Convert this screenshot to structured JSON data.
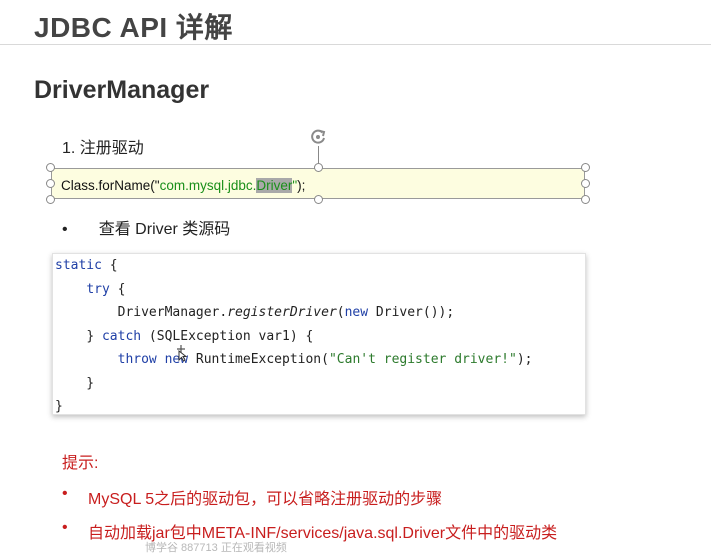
{
  "slide": {
    "title": "JDBC API 详解",
    "section": "DriverManager",
    "step": "1.  注册驱动",
    "textbox": {
      "prefix": "Class.forName(\"",
      "string_main": "com.mysql.jdbc.",
      "string_selected": "Driver",
      "suffix_quote": "\"",
      "suffix": ");"
    },
    "bullet": {
      "marker": "•",
      "text": "查看 Driver 类源码"
    },
    "code": {
      "line1_kw": "static",
      "line1_rest": " {",
      "line2_indent": "    ",
      "line2_kw": "try",
      "line2_rest": " {",
      "line3_indent": "        ",
      "line3_a": "DriverManager.",
      "line3_method": "registerDriver",
      "line3_b": "(",
      "line3_kw": "new",
      "line3_c": " Driver());",
      "line4_indent": "    ",
      "line4_a": "} ",
      "line4_kw": "catch",
      "line4_b": " (SQLException var1) {",
      "line5_indent": "        ",
      "line5_kw1": "throw",
      "line5_sp": " ",
      "line5_kw2": "new",
      "line5_b": " RuntimeException(",
      "line5_str": "\"Can't register driver!\"",
      "line5_c": ");",
      "line6": "    }",
      "line7": "}"
    },
    "tips": {
      "title": "提示:",
      "items": [
        {
          "marker": "•",
          "text": "MySQL 5之后的驱动包，可以省略注册驱动的步骤"
        },
        {
          "marker": "•",
          "text": "自动加载jar包中META-INF/services/java.sql.Driver文件中的驱动类"
        }
      ]
    },
    "watermark": "博学谷 887713 正在观看视频"
  },
  "colors": {
    "tip_red": "#c81e1e",
    "string_green": "#1a8f1a",
    "keyword_blue": "#1f3fa6",
    "textbox_fill": "#fdfde0"
  }
}
